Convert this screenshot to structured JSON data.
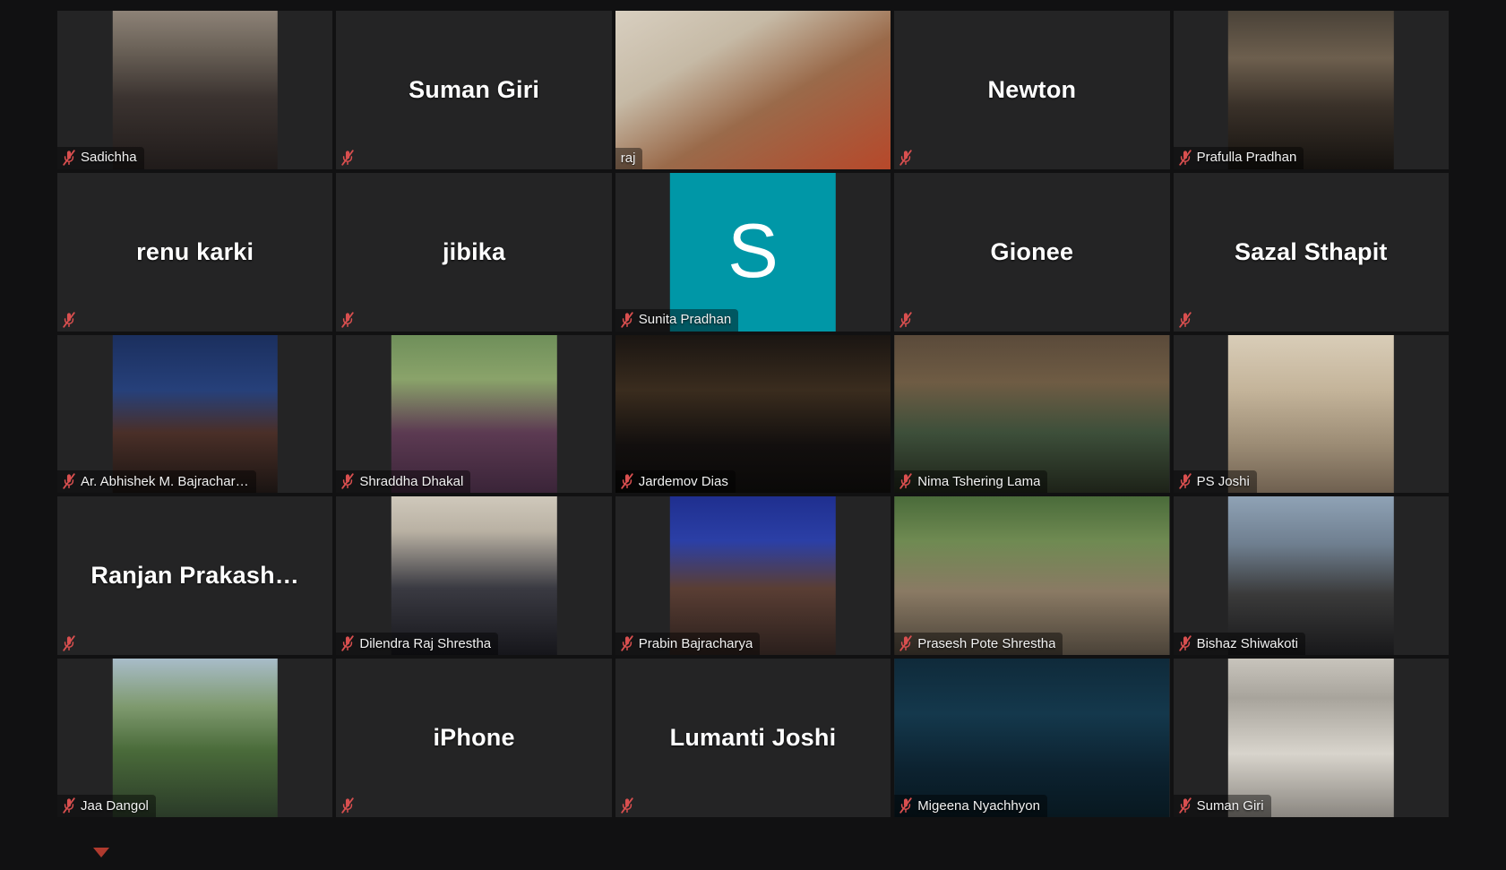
{
  "app": {
    "name": "Zoom Meeting",
    "view": "Gallery View",
    "background_color": "#111112",
    "tile_color": "#242425",
    "active_speaker_border_color": "#c9e04e",
    "mute_icon_color": "#d94f4f",
    "avatar_background_color": "#0097a7"
  },
  "icons": {
    "mic_muted": "microphone-muted-icon"
  },
  "grid": {
    "columns": 5,
    "rows": 5,
    "tiles": [
      {
        "name": "Sadichha",
        "kind": "video",
        "muted": true,
        "speaking": false,
        "video_wide": false,
        "bg": "linear-gradient(180deg,#8d8277 0%,#6b6258 24%,#3b3330 55%,#201b1a 100%)"
      },
      {
        "name": "Suman Giri",
        "kind": "name",
        "muted": true,
        "speaking": false,
        "video_wide": false,
        "bg": ""
      },
      {
        "name": "raj",
        "kind": "video",
        "muted": false,
        "speaking": true,
        "video_wide": true,
        "bg": "linear-gradient(150deg,#d8cfc0 0%,#c6baa6 30%,#9a6a4a 58%,#b7482a 100%)"
      },
      {
        "name": "Newton",
        "kind": "name",
        "muted": true,
        "speaking": false,
        "video_wide": false,
        "bg": ""
      },
      {
        "name": "Prafulla Pradhan",
        "kind": "video",
        "muted": true,
        "speaking": false,
        "video_wide": false,
        "bg": "linear-gradient(180deg,#4a4238 0%,#6d5f4e 30%,#3a3129 60%,#15120f 100%)"
      },
      {
        "name": "renu karki",
        "kind": "name",
        "muted": true,
        "speaking": false,
        "video_wide": false,
        "bg": ""
      },
      {
        "name": "jibika",
        "kind": "name",
        "muted": true,
        "speaking": false,
        "video_wide": false,
        "bg": ""
      },
      {
        "name": "Sunita Pradhan",
        "kind": "avatar",
        "initial": "S",
        "muted": true,
        "speaking": false,
        "video_wide": false,
        "bg": "#0097a7"
      },
      {
        "name": "Gionee",
        "kind": "name",
        "muted": true,
        "speaking": false,
        "video_wide": false,
        "bg": ""
      },
      {
        "name": "Sazal Sthapit",
        "kind": "name",
        "muted": true,
        "speaking": false,
        "video_wide": false,
        "bg": ""
      },
      {
        "name": "Ar. Abhishek M. Bajrachar…",
        "kind": "video",
        "muted": true,
        "speaking": false,
        "video_wide": false,
        "bg": "linear-gradient(180deg,#1b2f5e 0%,#26407a 35%,#4a2f28 62%,#1a1412 100%)"
      },
      {
        "name": "Shraddha Dhakal",
        "kind": "video",
        "muted": true,
        "speaking": false,
        "video_wide": false,
        "bg": "linear-gradient(180deg,#6f8f5a 0%,#8aa36a 28%,#5c3a52 62%,#3a2438 100%)"
      },
      {
        "name": "Jardemov Dias",
        "kind": "video",
        "muted": true,
        "speaking": false,
        "video_wide": true,
        "bg": "linear-gradient(180deg,#1a1512 0%,#3a2c1e 35%,#120f0e 70%,#0a0908 100%)"
      },
      {
        "name": "Nima Tshering Lama",
        "kind": "video",
        "muted": true,
        "speaking": false,
        "video_wide": true,
        "bg": "linear-gradient(180deg,#5a4a3a 0%,#6f5c44 30%,#3d4f3a 62%,#1d2218 100%)"
      },
      {
        "name": "PS Joshi",
        "kind": "video",
        "muted": true,
        "speaking": false,
        "video_wide": false,
        "bg": "linear-gradient(180deg,#d9cdb8 0%,#c4b49a 35%,#9b8b74 70%,#6f6050 100%)"
      },
      {
        "name": "Ranjan  Prakash…",
        "kind": "name",
        "muted": true,
        "speaking": false,
        "video_wide": false,
        "bg": ""
      },
      {
        "name": "Dilendra Raj Shrestha",
        "kind": "video",
        "muted": true,
        "speaking": false,
        "video_wide": false,
        "bg": "linear-gradient(180deg,#cfc8bb 0%,#b9b1a3 22%,#3a3a42 58%,#16161b 100%)"
      },
      {
        "name": "Prabin Bajracharya",
        "kind": "video",
        "muted": true,
        "speaking": false,
        "video_wide": false,
        "bg": "linear-gradient(180deg,#1f2f8f 0%,#2b3fa6 28%,#5a3e34 58%,#2a1f1c 100%)"
      },
      {
        "name": "Prasesh Pote Shrestha",
        "kind": "video",
        "muted": true,
        "speaking": false,
        "video_wide": true,
        "bg": "linear-gradient(180deg,#4a6b3a 0%,#6f8a52 28%,#8a7a64 60%,#4a4238 100%)"
      },
      {
        "name": "Bishaz Shiwakoti",
        "kind": "video",
        "muted": true,
        "speaking": false,
        "video_wide": false,
        "bg": "linear-gradient(180deg,#8fa2b5 0%,#6f7f90 30%,#3a3a3a 62%,#18181a 100%)"
      },
      {
        "name": "Jaa Dangol",
        "kind": "video",
        "muted": true,
        "speaking": false,
        "video_wide": false,
        "bg": "linear-gradient(180deg,#a8bcc9 0%,#7f9a6f 30%,#4a6b3a 58%,#2a3a28 100%)"
      },
      {
        "name": "iPhone",
        "kind": "name",
        "muted": true,
        "speaking": false,
        "video_wide": false,
        "bg": ""
      },
      {
        "name": "Lumanti Joshi",
        "kind": "name",
        "muted": true,
        "speaking": false,
        "video_wide": false,
        "bg": ""
      },
      {
        "name": "Migeena Nyachhyon",
        "kind": "video",
        "muted": true,
        "speaking": false,
        "video_wide": true,
        "bg": "linear-gradient(180deg,#0f2a3a 0%,#14384c 35%,#0c2230 70%,#081820 100%)"
      },
      {
        "name": "Suman Giri",
        "kind": "video",
        "muted": true,
        "speaking": false,
        "video_wide": false,
        "bg": "linear-gradient(180deg,#c8c4bc 0%,#a8a49c 25%,#d8d4cc 60%,#8a8680 100%)"
      }
    ]
  }
}
